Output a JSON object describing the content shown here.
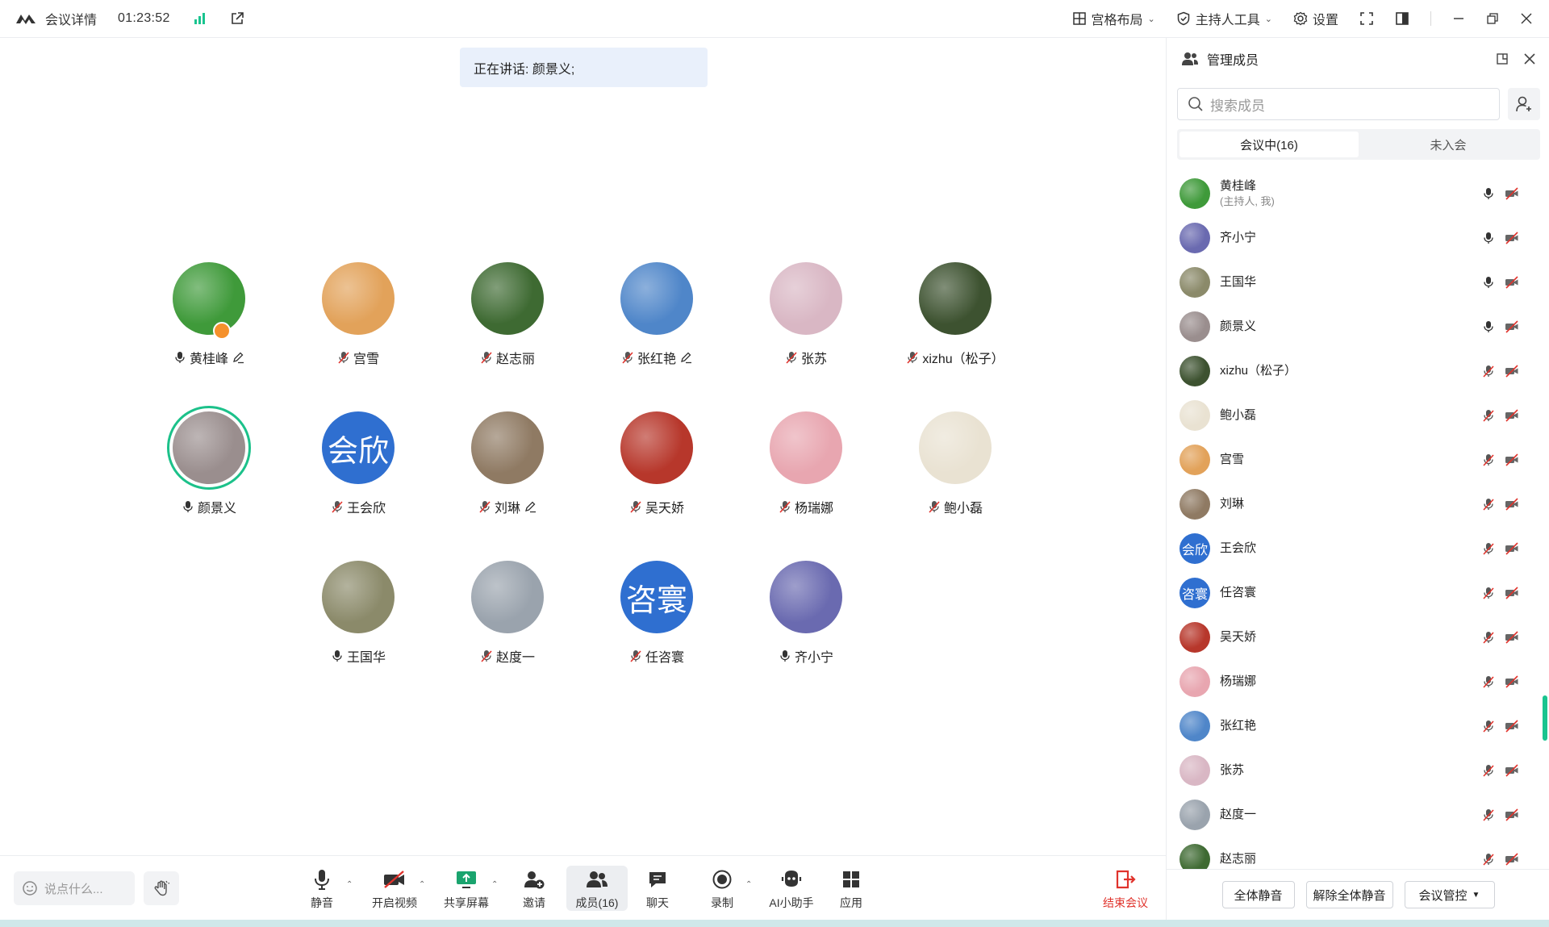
{
  "topbar": {
    "meeting_details": "会议详情",
    "timer": "01:23:52",
    "layout_label": "宫格布局",
    "host_tools_label": "主持人工具",
    "settings_label": "设置"
  },
  "speaking_banner": "正在讲话: 颜景义;",
  "grid": [
    {
      "name": "黄桂峰",
      "mic": "on",
      "edit": true,
      "host": true,
      "color": "#3f9a3a"
    },
    {
      "name": "宫雪",
      "mic": "off",
      "color": "#e2a25a"
    },
    {
      "name": "赵志丽",
      "mic": "off",
      "color": "#3e6a32"
    },
    {
      "name": "张红艳",
      "mic": "off",
      "edit": true,
      "color": "#4f86c9"
    },
    {
      "name": "张苏",
      "mic": "off",
      "color": "#d9b7c4"
    },
    {
      "name": "xizhu（松子）",
      "mic": "off",
      "color": "#3d5230"
    },
    {
      "name": "颜景义",
      "mic": "on",
      "speaking": true,
      "color": "#9a8e8e"
    },
    {
      "name": "王会欣",
      "mic": "off",
      "text_avatar": "会欣"
    },
    {
      "name": "刘琳",
      "mic": "off",
      "edit": true,
      "color": "#8f7a63"
    },
    {
      "name": "吴天娇",
      "mic": "off",
      "color": "#b7372b"
    },
    {
      "name": "杨瑞娜",
      "mic": "off",
      "color": "#e8a6b0"
    },
    {
      "name": "鲍小磊",
      "mic": "off",
      "color": "#e9e2d2"
    },
    {
      "name": "王国华",
      "mic": "on",
      "color": "#8b8a6a"
    },
    {
      "name": "赵度一",
      "mic": "off",
      "color": "#9aa3ad"
    },
    {
      "name": "任咨寰",
      "mic": "off",
      "text_avatar": "咨寰"
    },
    {
      "name": "齐小宁",
      "mic": "on",
      "color": "#6a6ab0"
    }
  ],
  "toolbar": {
    "chat_placeholder": "说点什么...",
    "mute": "静音",
    "video": "开启视频",
    "share": "共享屏幕",
    "invite": "邀请",
    "members": "成员(16)",
    "chat": "聊天",
    "record": "录制",
    "ai": "AI小助手",
    "apps": "应用",
    "end": "结束会议"
  },
  "panel": {
    "title": "管理成员",
    "search_placeholder": "搜索成员",
    "tab_in": "会议中(16)",
    "tab_out": "未入会",
    "members": [
      {
        "name": "黄桂峰",
        "sub": "(主持人, 我)",
        "mic": "on",
        "color": "#3f9a3a"
      },
      {
        "name": "齐小宁",
        "mic": "on",
        "color": "#6a6ab0"
      },
      {
        "name": "王国华",
        "mic": "on",
        "color": "#8b8a6a"
      },
      {
        "name": "颜景义",
        "mic": "on",
        "color": "#9a8e8e"
      },
      {
        "name": "xizhu（松子）",
        "mic": "off",
        "color": "#3d5230"
      },
      {
        "name": "鲍小磊",
        "mic": "off",
        "color": "#e9e2d2"
      },
      {
        "name": "宫雪",
        "mic": "off",
        "color": "#e2a25a"
      },
      {
        "name": "刘琳",
        "mic": "off",
        "color": "#8f7a63"
      },
      {
        "name": "王会欣",
        "mic": "off",
        "text_avatar": "会欣"
      },
      {
        "name": "任咨寰",
        "mic": "off",
        "text_avatar": "咨寰"
      },
      {
        "name": "吴天娇",
        "mic": "off",
        "color": "#b7372b"
      },
      {
        "name": "杨瑞娜",
        "mic": "off",
        "color": "#e8a6b0"
      },
      {
        "name": "张红艳",
        "mic": "off",
        "color": "#4f86c9"
      },
      {
        "name": "张苏",
        "mic": "off",
        "color": "#d9b7c4"
      },
      {
        "name": "赵度一",
        "mic": "off",
        "color": "#9aa3ad"
      },
      {
        "name": "赵志丽",
        "mic": "off",
        "color": "#3e6a32"
      }
    ],
    "mute_all": "全体静音",
    "unmute_all": "解除全体静音",
    "meeting_control": "会议管控"
  },
  "colors": {
    "accent": "#1cc18a",
    "end": "#e0332c",
    "text_avatar": "#2f6fd0"
  }
}
